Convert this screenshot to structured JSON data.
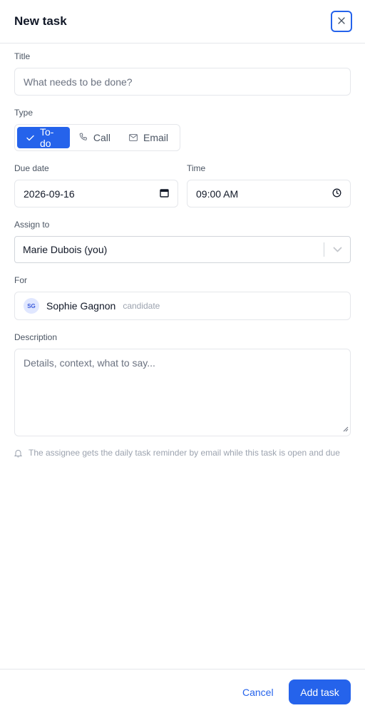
{
  "header": {
    "title": "New task"
  },
  "fields": {
    "title": {
      "label": "Title",
      "placeholder": "What needs to be done?"
    },
    "type": {
      "label": "Type",
      "options": [
        {
          "label": "To-do",
          "icon": "check-icon",
          "selected": true
        },
        {
          "label": "Call",
          "icon": "phone-icon",
          "selected": false
        },
        {
          "label": "Email",
          "icon": "mail-icon",
          "selected": false
        }
      ]
    },
    "due_date": {
      "label": "Due date",
      "value": "2026-09-16"
    },
    "time": {
      "label": "Time",
      "value": "09:00 AM"
    },
    "assign_to": {
      "label": "Assign to",
      "value": "Marie Dubois (you)"
    },
    "for": {
      "label": "For",
      "initials": "SG",
      "name": "Sophie Gagnon",
      "tag": "candidate"
    },
    "description": {
      "label": "Description",
      "placeholder": "Details, context, what to say..."
    }
  },
  "hint": "The assignee gets the daily task reminder by email while this task is open and due",
  "footer": {
    "cancel_label": "Cancel",
    "add_label": "Add task"
  },
  "colors": {
    "accent": "#2563eb",
    "border": "#e5e7eb",
    "muted": "#9ca3af"
  }
}
